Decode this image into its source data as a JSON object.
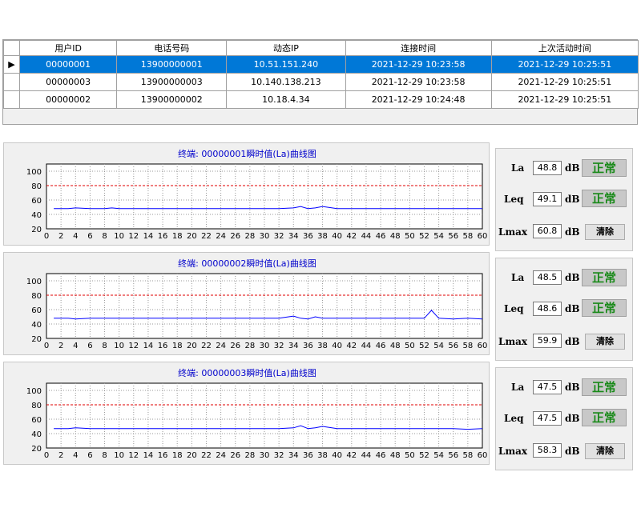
{
  "table": {
    "headers": [
      "用户ID",
      "电话号码",
      "动态IP",
      "连接时间",
      "上次活动时间"
    ],
    "rows": [
      {
        "id": "00000001",
        "phone": "13900000001",
        "ip": "10.51.151.240",
        "connect": "2021-12-29  10:23:58",
        "last": "2021-12-29  10:25:51",
        "selected": true
      },
      {
        "id": "00000003",
        "phone": "13900000003",
        "ip": "10.140.138.213",
        "connect": "2021-12-29  10:23:58",
        "last": "2021-12-29  10:25:51",
        "selected": false
      },
      {
        "id": "00000002",
        "phone": "13900000002",
        "ip": "10.18.4.34",
        "connect": "2021-12-29  10:24:48",
        "last": "2021-12-29  10:25:51",
        "selected": false
      }
    ]
  },
  "colors": {
    "selection": "#0078d7",
    "series": "#0000ff",
    "threshold": "#e00000",
    "status_text": "#1a8a1a",
    "title": "#0000cc"
  },
  "panels": [
    {
      "title": "终端: 00000001瞬时值(La)曲线图",
      "la": "48.8",
      "leq": "49.1",
      "lmax": "60.8",
      "status1": "正常",
      "status2": "正常",
      "clear": "清除",
      "label_la": "La",
      "label_leq": "Leq",
      "label_lmax": "Lmax",
      "unit": "dB"
    },
    {
      "title": "终端: 00000002瞬时值(La)曲线图",
      "la": "48.5",
      "leq": "48.6",
      "lmax": "59.9",
      "status1": "正常",
      "status2": "正常",
      "clear": "清除",
      "label_la": "La",
      "label_leq": "Leq",
      "label_lmax": "Lmax",
      "unit": "dB"
    },
    {
      "title": "终端: 00000003瞬时值(La)曲线图",
      "la": "47.5",
      "leq": "47.5",
      "lmax": "58.3",
      "status1": "正常",
      "status2": "正常",
      "clear": "清除",
      "label_la": "La",
      "label_leq": "Leq",
      "label_lmax": "Lmax",
      "unit": "dB"
    }
  ],
  "chart_data": [
    {
      "type": "line",
      "x_ticks": [
        0,
        2,
        4,
        6,
        8,
        10,
        12,
        14,
        16,
        18,
        20,
        22,
        24,
        26,
        28,
        30,
        32,
        34,
        36,
        38,
        40,
        42,
        44,
        46,
        48,
        50,
        52,
        54,
        56,
        58,
        60
      ],
      "y_ticks": [
        20,
        40,
        60,
        80,
        100
      ],
      "xlim": [
        0,
        60
      ],
      "ylim": [
        20,
        110
      ],
      "threshold": 80,
      "grid": true,
      "series": [
        {
          "x": [
            1,
            3,
            4,
            6,
            8,
            9,
            10,
            12,
            14,
            16,
            18,
            20,
            22,
            24,
            26,
            28,
            30,
            32,
            34,
            35,
            36,
            37,
            38,
            40,
            42,
            44,
            46,
            48,
            50,
            52,
            54,
            56,
            58,
            60
          ],
          "y": [
            48,
            48,
            49,
            48,
            48,
            49,
            48,
            48,
            48,
            48,
            48,
            48,
            48,
            48,
            48,
            48,
            48,
            48,
            49,
            51,
            48,
            49,
            51,
            48,
            48,
            48,
            48,
            48,
            48,
            48,
            48,
            48,
            48,
            48
          ]
        }
      ]
    },
    {
      "type": "line",
      "x_ticks": [
        0,
        2,
        4,
        6,
        8,
        10,
        12,
        14,
        16,
        18,
        20,
        22,
        24,
        26,
        28,
        30,
        32,
        34,
        36,
        38,
        40,
        42,
        44,
        46,
        48,
        50,
        52,
        54,
        56,
        58,
        60
      ],
      "y_ticks": [
        20,
        40,
        60,
        80,
        100
      ],
      "xlim": [
        0,
        60
      ],
      "ylim": [
        20,
        110
      ],
      "threshold": 80,
      "grid": true,
      "series": [
        {
          "x": [
            1,
            3,
            4,
            6,
            8,
            10,
            12,
            14,
            16,
            18,
            20,
            22,
            24,
            26,
            28,
            30,
            32,
            34,
            35,
            36,
            37,
            38,
            40,
            42,
            44,
            46,
            48,
            50,
            52,
            53,
            54,
            56,
            58,
            60
          ],
          "y": [
            48,
            48,
            47,
            48,
            48,
            48,
            48,
            48,
            48,
            48,
            48,
            48,
            48,
            48,
            48,
            48,
            48,
            51,
            48,
            47,
            50,
            48,
            48,
            48,
            48,
            48,
            48,
            48,
            48,
            59,
            48,
            47,
            48,
            47
          ]
        }
      ]
    },
    {
      "type": "line",
      "x_ticks": [
        0,
        2,
        4,
        6,
        8,
        10,
        12,
        14,
        16,
        18,
        20,
        22,
        24,
        26,
        28,
        30,
        32,
        34,
        36,
        38,
        40,
        42,
        44,
        46,
        48,
        50,
        52,
        54,
        56,
        58,
        60
      ],
      "y_ticks": [
        20,
        40,
        60,
        80,
        100
      ],
      "xlim": [
        0,
        60
      ],
      "ylim": [
        20,
        110
      ],
      "threshold": 80,
      "grid": true,
      "series": [
        {
          "x": [
            1,
            3,
            4,
            6,
            8,
            10,
            12,
            14,
            16,
            18,
            20,
            22,
            24,
            26,
            28,
            30,
            32,
            34,
            35,
            36,
            37,
            38,
            40,
            42,
            44,
            46,
            48,
            50,
            52,
            54,
            56,
            58,
            60
          ],
          "y": [
            47,
            47,
            48,
            47,
            47,
            47,
            47,
            47,
            47,
            47,
            47,
            47,
            47,
            47,
            47,
            47,
            47,
            48,
            51,
            47,
            48,
            50,
            47,
            47,
            47,
            47,
            47,
            47,
            47,
            47,
            47,
            46,
            47
          ]
        }
      ]
    }
  ]
}
